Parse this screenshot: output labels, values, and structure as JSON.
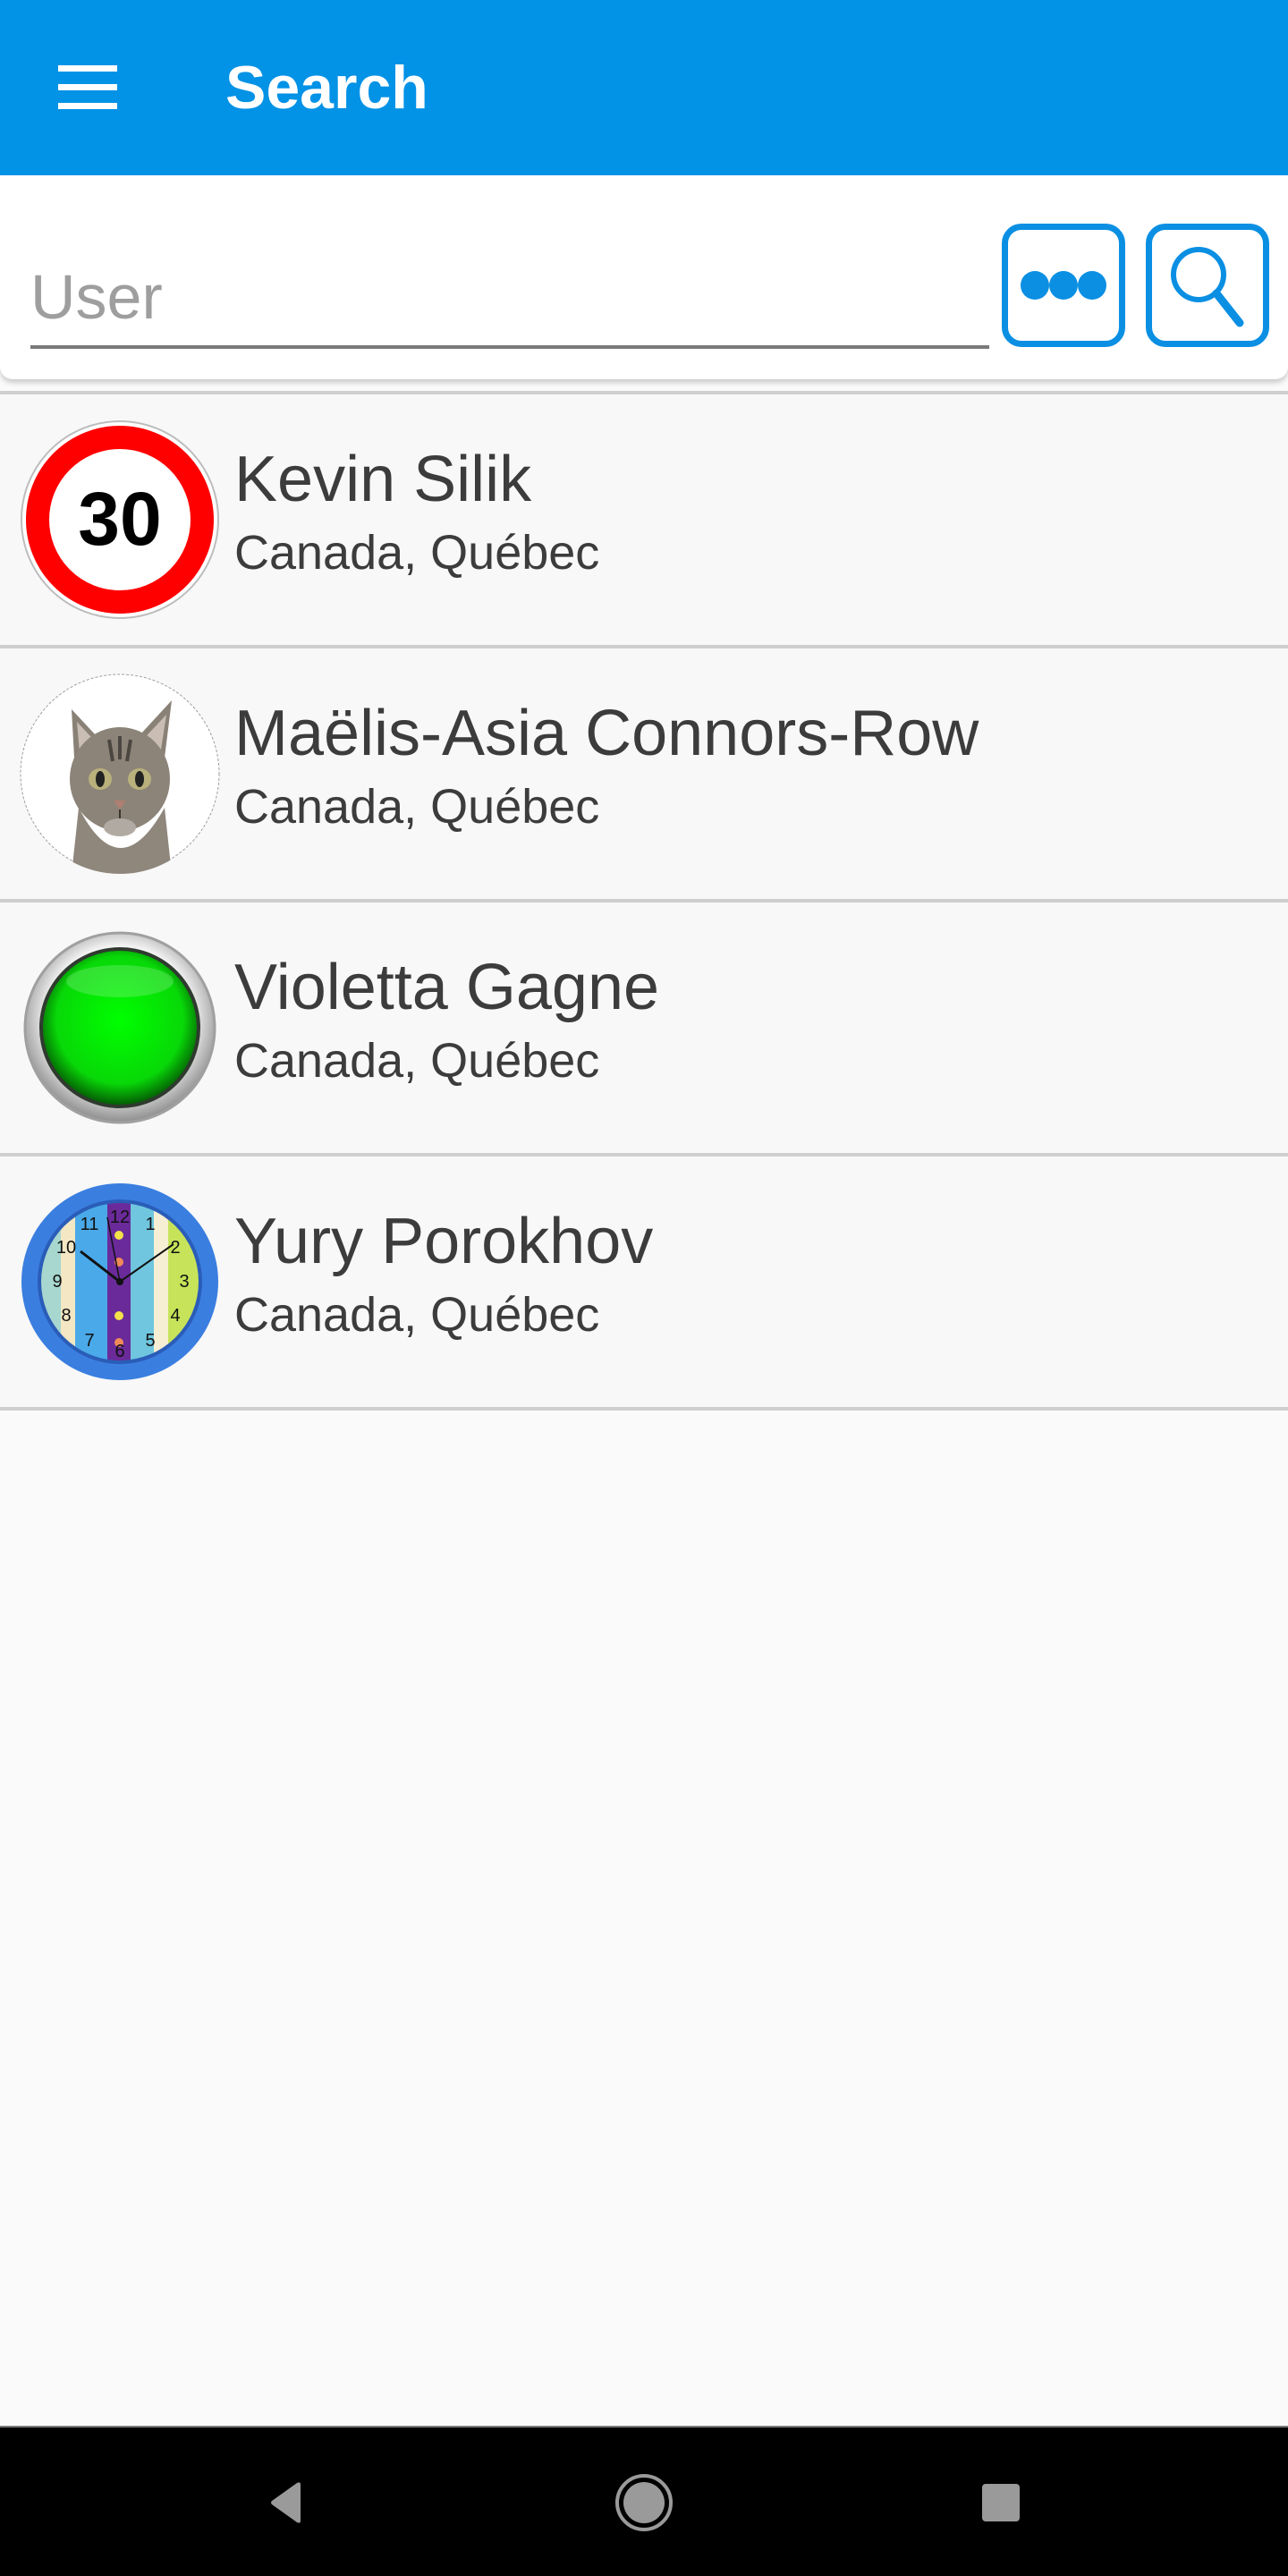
{
  "app_bar": {
    "title": "Search",
    "menu_icon": "hamburger-menu-icon",
    "background_color": "#0292e6"
  },
  "search": {
    "input_value": "",
    "input_placeholder": "User",
    "more_button_icon": "more-dots-icon",
    "search_button_icon": "magnifier-icon",
    "accent_color": "#0a8fe3"
  },
  "results": [
    {
      "name": "Kevin Silik",
      "location": "Canada, Québec",
      "avatar": "speed-limit-30-sign",
      "avatar_text": "30"
    },
    {
      "name": "Maëlis-Asia Connors-Row",
      "location": "Canada, Québec",
      "avatar": "tabby-cat-photo"
    },
    {
      "name": "Violetta Gagne",
      "location": "Canada, Québec",
      "avatar": "green-button-light"
    },
    {
      "name": "Yury Porokhov",
      "location": "Canada, Québec",
      "avatar": "colorful-wall-clock"
    }
  ],
  "nav_bar": {
    "back_icon": "back-triangle-icon",
    "home_icon": "home-circle-icon",
    "recents_icon": "recents-square-icon"
  }
}
